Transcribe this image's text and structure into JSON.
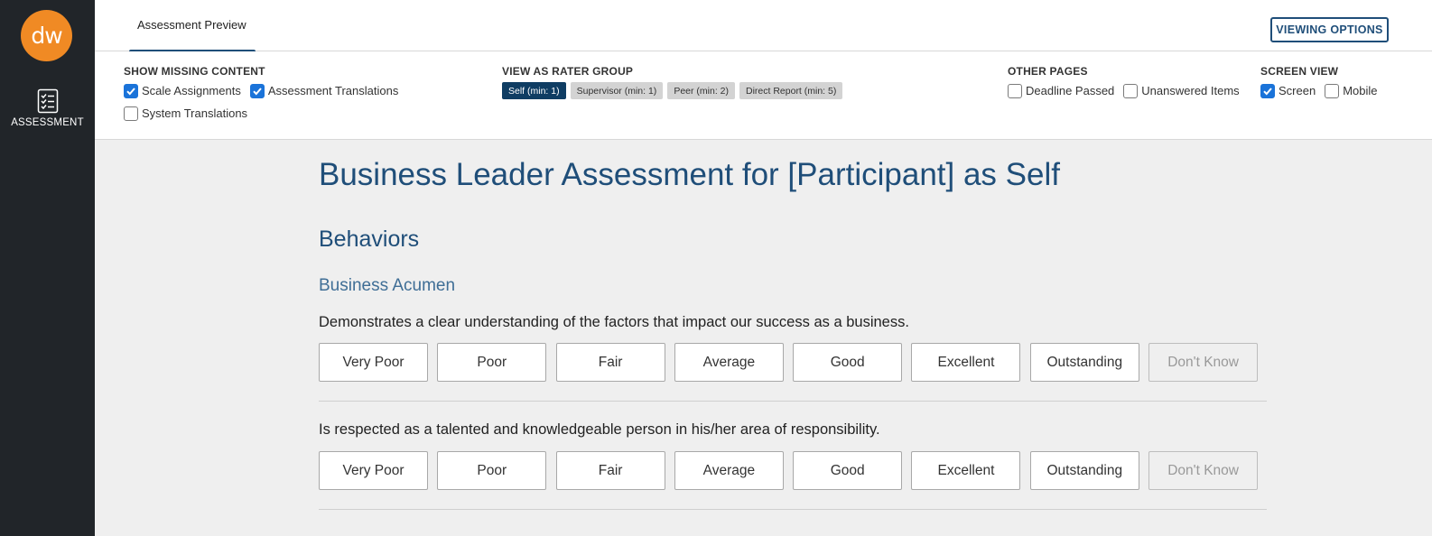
{
  "brand": {
    "logo_text": "dw",
    "accent": "#f08a24"
  },
  "sidebar": {
    "items": [
      {
        "label": "ASSESSMENT",
        "icon": "checklist-icon"
      }
    ]
  },
  "header": {
    "tab_label": "Assessment Preview",
    "viewing_options_label": "VIEWING OPTIONS"
  },
  "options": {
    "missing": {
      "title": "SHOW MISSING CONTENT",
      "items": [
        {
          "label": "Scale Assignments",
          "checked": true
        },
        {
          "label": "Assessment Translations",
          "checked": true
        },
        {
          "label": "System Translations",
          "checked": false
        }
      ]
    },
    "rater": {
      "title": "VIEW AS RATER GROUP",
      "groups": [
        {
          "label": "Self (min: 1)",
          "active": true
        },
        {
          "label": "Supervisor (min: 1)",
          "active": false
        },
        {
          "label": "Peer (min: 2)",
          "active": false
        },
        {
          "label": "Direct Report (min: 5)",
          "active": false
        }
      ]
    },
    "other": {
      "title": "OTHER PAGES",
      "items": [
        {
          "label": "Deadline Passed",
          "checked": false
        },
        {
          "label": "Unanswered Items",
          "checked": false
        }
      ]
    },
    "screen": {
      "title": "SCREEN VIEW",
      "items": [
        {
          "label": "Screen",
          "checked": true
        },
        {
          "label": "Mobile",
          "checked": false
        }
      ]
    }
  },
  "main": {
    "title": "Business Leader Assessment for [Participant] as Self",
    "section": "Behaviors",
    "subsection": "Business Acumen",
    "scale_options": [
      "Very Poor",
      "Poor",
      "Fair",
      "Average",
      "Good",
      "Excellent",
      "Outstanding",
      "Don't Know"
    ],
    "questions": [
      {
        "text": "Demonstrates a clear understanding of the factors that impact our success as a business."
      },
      {
        "text": "Is respected as a talented and knowledgeable person in his/her area of responsibility."
      }
    ]
  },
  "colors": {
    "primary": "#1f4e79",
    "sidebar_bg": "#212529",
    "checkbox": "#1a73d9",
    "active_pill": "#0f3d63"
  }
}
